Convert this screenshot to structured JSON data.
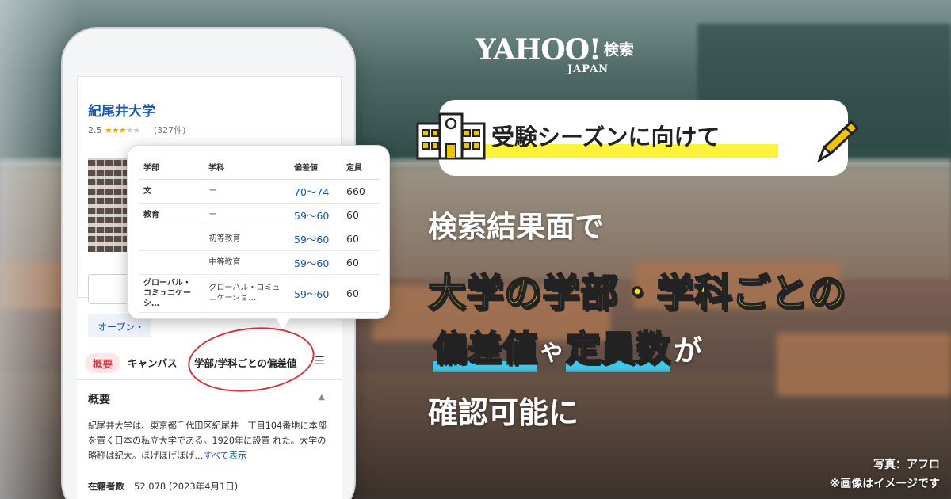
{
  "colors": {
    "accent_yellow": "#ffe500",
    "accent_blue": "#3cc8e6",
    "link_blue": "#1a55b8",
    "circle_red": "#e0303a"
  },
  "branding": {
    "logo_text": "YAHOO!",
    "logo_sub": "JAPAN",
    "service": "検索"
  },
  "phone": {
    "uni_name": "紀尾井大学",
    "rating_value": "2.5",
    "rating_stars": 2.5,
    "review_count": "(327件)",
    "open_link": "オープン・",
    "tabs": {
      "active": "概要",
      "campus": "キャンパス",
      "deviation": "学部/学科ごとの偏差値",
      "menu_icon": "menu-icon"
    },
    "summary_title": "概要",
    "summary_text": "紀尾井大学は、東京都千代田区紀尾井一丁目104番地に本部を置く日本の私立大学である。1920年に設置 れた。大学の略称は紀大。ほげほげほげ…",
    "summary_more": "すべて表示",
    "enrollment_label": "在籍者数",
    "enrollment_value": "52,078 (2023年4月1日)"
  },
  "table": {
    "headers": {
      "faculty": "学部",
      "dept": "学科",
      "dev": "偏差値",
      "cap": "定員"
    },
    "rows": [
      {
        "faculty": "文",
        "dept": "ー",
        "dev": "70〜74",
        "cap": "660"
      },
      {
        "faculty": "教育",
        "dept": "ー",
        "dev": "59〜60",
        "cap": "60"
      },
      {
        "faculty": "",
        "dept": "初等教育",
        "dev": "59〜60",
        "cap": "60"
      },
      {
        "faculty": "",
        "dept": "中等教育",
        "dev": "59〜60",
        "cap": "60"
      },
      {
        "faculty": "グローバル・コミュニケーシ…",
        "dept": "グローバル・コミュニケーショ…",
        "dev": "59〜60",
        "cap": "60"
      }
    ]
  },
  "headline": {
    "tagline": "受験シーズンに向けて",
    "line1": "検索結果面で",
    "line2": "大学の学部・学科ごとの",
    "line3_a": "偏差値",
    "line3_ya": "や",
    "line3_b": "定員数",
    "line3_ga": "が",
    "line4": "確認可能に"
  },
  "credits": {
    "photo": "写真：アフロ",
    "note": "※画像はイメージです"
  }
}
